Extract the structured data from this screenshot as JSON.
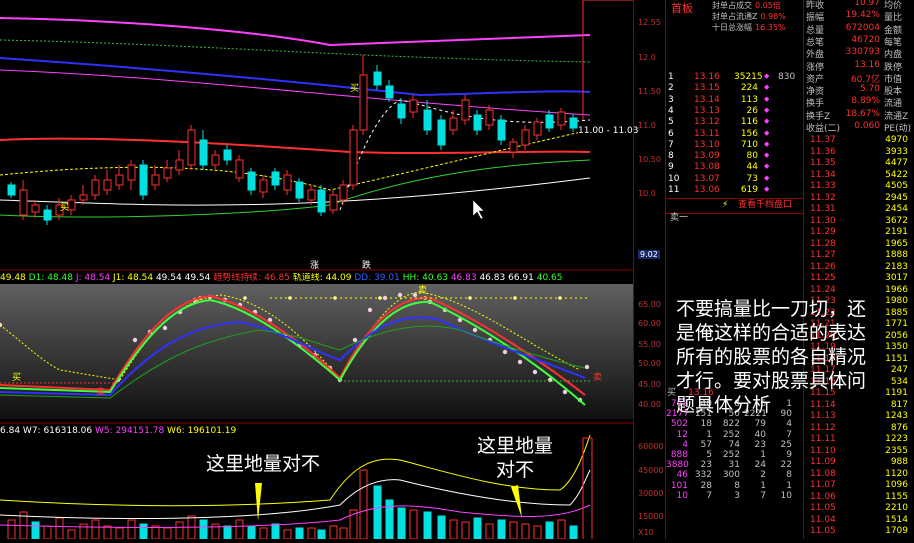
{
  "chart_header": {
    "kdj_line": [
      "49.48",
      "D1: 48.48",
      "J: 48.54",
      "J1: 48.54",
      "49.54",
      "49.54",
      "趋势线持续: 46.85",
      "轨道线: 44.09",
      "DD: 39.01",
      "HH: 40.63",
      "46.83",
      "46.83",
      "66.91",
      "40.65"
    ],
    "vol_line": [
      "6.84",
      "W7: 616318.06",
      "W5: 294151.78",
      "W6: 196101.19"
    ]
  },
  "price_axis": [
    "12.55",
    "12.0",
    "11.50",
    "11.0",
    "10.50",
    "10.0",
    "9.02"
  ],
  "osc_axis": [
    "65.00",
    "60.00",
    "55.00",
    "50.00",
    "45.00",
    "40.00"
  ],
  "vol_axis": [
    "60000",
    "45000",
    "30000",
    "15000",
    "X10"
  ],
  "range_label": "11.00 - 11.03",
  "panel_title": "首板",
  "top_stats": [
    {
      "label": "封单占成交",
      "value": "0.05倍"
    },
    {
      "label": "封单占流通Z",
      "value": "0.98%"
    },
    {
      "label": "十日总涨幅",
      "value": "16.35%"
    }
  ],
  "sell_rows": [
    {
      "n": "1",
      "price": "13.16",
      "vol": "35215",
      "extra": "830"
    },
    {
      "n": "2",
      "price": "13.15",
      "vol": "224",
      "extra": ""
    },
    {
      "n": "3",
      "price": "13.14",
      "vol": "113",
      "extra": ""
    },
    {
      "n": "4",
      "price": "13.13",
      "vol": "26",
      "extra": ""
    },
    {
      "n": "5",
      "price": "13.12",
      "vol": "116",
      "extra": ""
    },
    {
      "n": "6",
      "price": "13.11",
      "vol": "156",
      "extra": ""
    },
    {
      "n": "7",
      "price": "13.10",
      "vol": "710",
      "extra": ""
    },
    {
      "n": "8",
      "price": "13.09",
      "vol": "80",
      "extra": ""
    },
    {
      "n": "9",
      "price": "13.08",
      "vol": "44",
      "extra": ""
    },
    {
      "n": "10",
      "price": "13.07",
      "vol": "73",
      "extra": ""
    },
    {
      "n": "11",
      "price": "13.06",
      "vol": "619",
      "extra": ""
    }
  ],
  "view_button": "查看千档盘口",
  "sell_one_label": "卖一",
  "buy_label": "买",
  "buy_price": "13.16",
  "buy_rows": [
    [
      "763",
      "40",
      "8",
      "6",
      "1"
    ],
    [
      "2177",
      "151",
      "50",
      "2221",
      "90"
    ],
    [
      "502",
      "18",
      "822",
      "79",
      "4"
    ],
    [
      "12",
      "1",
      "252",
      "40",
      "7"
    ],
    [
      "4",
      "57",
      "74",
      "23",
      "25"
    ],
    [
      "888",
      "5",
      "252",
      "1",
      "9"
    ],
    [
      "3880",
      "23",
      "31",
      "24",
      "22"
    ],
    [
      "46",
      "332",
      "300",
      "2",
      "8"
    ],
    [
      "101",
      "28",
      "8",
      "1",
      "1"
    ],
    [
      "10",
      "7",
      "3",
      "7",
      "10"
    ]
  ],
  "info_rows": [
    {
      "l": "昨收",
      "v": "10.97",
      "r": "均价"
    },
    {
      "l": "振幅",
      "v": "19.42%",
      "r": "量比"
    },
    {
      "l": "总量",
      "v": "672004",
      "r": "金额"
    },
    {
      "l": "总笔",
      "v": "46720",
      "r": "每笔"
    },
    {
      "l": "外盘",
      "v": "330793",
      "r": "内盘"
    },
    {
      "l": "涨停",
      "v": "13.16",
      "r": "跌停"
    },
    {
      "l": "资产",
      "v": "60.7亿",
      "r": "市值"
    },
    {
      "l": "净资",
      "v": "5.70",
      "r": "股本"
    },
    {
      "l": "换手",
      "v": "8.89%",
      "r": "流通"
    },
    {
      "l": "换手Z",
      "v": "18.67%",
      "r": "流通Z"
    },
    {
      "l": "收益(二)",
      "v": "0.060",
      "r": "PE(动)"
    }
  ],
  "tape": [
    [
      "11.37",
      "4970"
    ],
    [
      "11.36",
      "3933"
    ],
    [
      "11.35",
      "4477"
    ],
    [
      "11.34",
      "5422"
    ],
    [
      "11.33",
      "4505"
    ],
    [
      "11.32",
      "2945"
    ],
    [
      "11.31",
      "2454"
    ],
    [
      "11.30",
      "3672"
    ],
    [
      "11.29",
      "2191"
    ],
    [
      "11.28",
      "1965"
    ],
    [
      "11.27",
      "1888"
    ],
    [
      "11.26",
      "2183"
    ],
    [
      "11.25",
      "3017"
    ],
    [
      "11.24",
      "1966"
    ],
    [
      "11.23",
      "1980"
    ],
    [
      "11.22",
      "1885"
    ],
    [
      "11.21",
      "1771"
    ],
    [
      "11.20",
      "2056"
    ],
    [
      "11.19",
      "1350"
    ],
    [
      "11.18",
      "1151"
    ],
    [
      "11.17",
      "247"
    ],
    [
      "11.16",
      "534"
    ],
    [
      "11.15",
      "1191"
    ],
    [
      "11.14",
      "817"
    ],
    [
      "11.13",
      "1243"
    ],
    [
      "11.12",
      "876"
    ],
    [
      "11.11",
      "1223"
    ],
    [
      "11.10",
      "2355"
    ],
    [
      "11.09",
      "988"
    ],
    [
      "11.08",
      "1120"
    ],
    [
      "11.07",
      "1096"
    ],
    [
      "11.06",
      "1155"
    ],
    [
      "11.05",
      "2210"
    ],
    [
      "11.04",
      "1514"
    ],
    [
      "11.05",
      "1709"
    ]
  ],
  "chart_markers": {
    "buy1": "买",
    "buy2": "买",
    "sell1": "卖",
    "sell2": "卖",
    "osc_buy": "买",
    "osc_sell": "卖",
    "t1": "涨",
    "t2": "跌"
  },
  "annotations": {
    "overlay": "不要搞量比一刀切，还\n是俺这样的合适的表达\n所有的股票的各自精况\n才行。要对股票具体问\n题具体分析",
    "left": "这里地量对不",
    "right": "这里地量\n对不"
  },
  "colors": {
    "up": "#ff3030",
    "down": "#00e0e0",
    "yellow": "#ffff00",
    "axis": "#8b0000"
  }
}
